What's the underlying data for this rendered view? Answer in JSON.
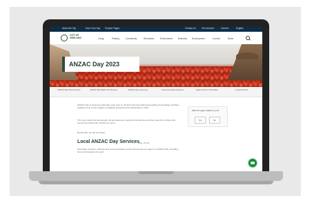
{
  "topbar": {
    "left_1": "About the City",
    "left_2": "Have Your Say",
    "left_3": "Popular Pages",
    "right_1": "Contact Us",
    "right_2": "Get Involved",
    "right_3": "Careers",
    "right_4": "English"
  },
  "header": {
    "logo_text": "CITY OF GEELONG",
    "nav": [
      "Living",
      "Parking",
      "Community",
      "Recreation",
      "Environment",
      "Business",
      "Development",
      "Council",
      "News"
    ]
  },
  "hero": {
    "title": "ANZAC Day 2023"
  },
  "subnav": [
    "ANZAC Day Dawn Service",
    "ANZAC Day March and Service",
    "ANZAC Day Ceremony",
    "Commemorative Services",
    "Dawn Service Information",
    "Local Services"
  ],
  "body": {
    "p1": "ANZAC Day is observed nationally each year on 25 April commemorating the landing of Australian and New Zealand Army Corps soldiers at Gallipoli during the First World War in 1915.",
    "p2": "This year marks the anniversary. All are welcome to attend local services and pay respects to those who served and those who continue to serve.",
    "p3": "Remember, we will not forget.",
    "h2": "Local ANZAC Day Services",
    "h2_date": "Wed, 25 Apr",
    "p4": "Find dawn services, marches and commemorative events held across our region on ANZAC Day, including times and locations for each."
  },
  "feedback": {
    "label": "Was this page helpful to you?",
    "yes": "Yes",
    "no": "No"
  }
}
